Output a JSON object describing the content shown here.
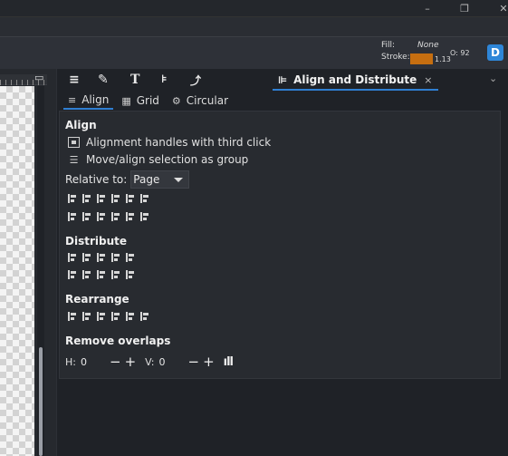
{
  "window": {
    "minimize_glyph": "–",
    "maximize_glyph": "❐",
    "close_glyph": "✕"
  },
  "style_indicator": {
    "fill_label": "Fill:",
    "fill_value": "None",
    "stroke_label": "Stroke:",
    "stroke_color": "#c66e10",
    "stroke_width": "1.13",
    "opacity": "O: 92"
  },
  "dock": {
    "tab_icons": [
      "objects-icon",
      "fill-stroke-icon",
      "text-icon",
      "document-properties-icon",
      "xml-icon"
    ],
    "active_tab": {
      "label": "Align and Distribute",
      "close": "×"
    },
    "chevron": "⌄"
  },
  "subtabs": [
    {
      "label": "Align",
      "icon": "≡"
    },
    {
      "label": "Grid",
      "icon": "▦"
    },
    {
      "label": "Circular",
      "icon": "⚙"
    }
  ],
  "align": {
    "heading": "Align",
    "option1": "Alignment handles with third click",
    "option2": "Move/align selection as group",
    "relative_label": "Relative to:",
    "relative_value": "Page"
  },
  "distribute": {
    "heading": "Distribute"
  },
  "rearrange": {
    "heading": "Rearrange"
  },
  "remove_overlaps": {
    "heading": "Remove overlaps",
    "h_label": "H:",
    "h_value": "0",
    "v_label": "V:",
    "v_value": "0",
    "minus": "−",
    "plus": "+",
    "apply": "ıll"
  }
}
